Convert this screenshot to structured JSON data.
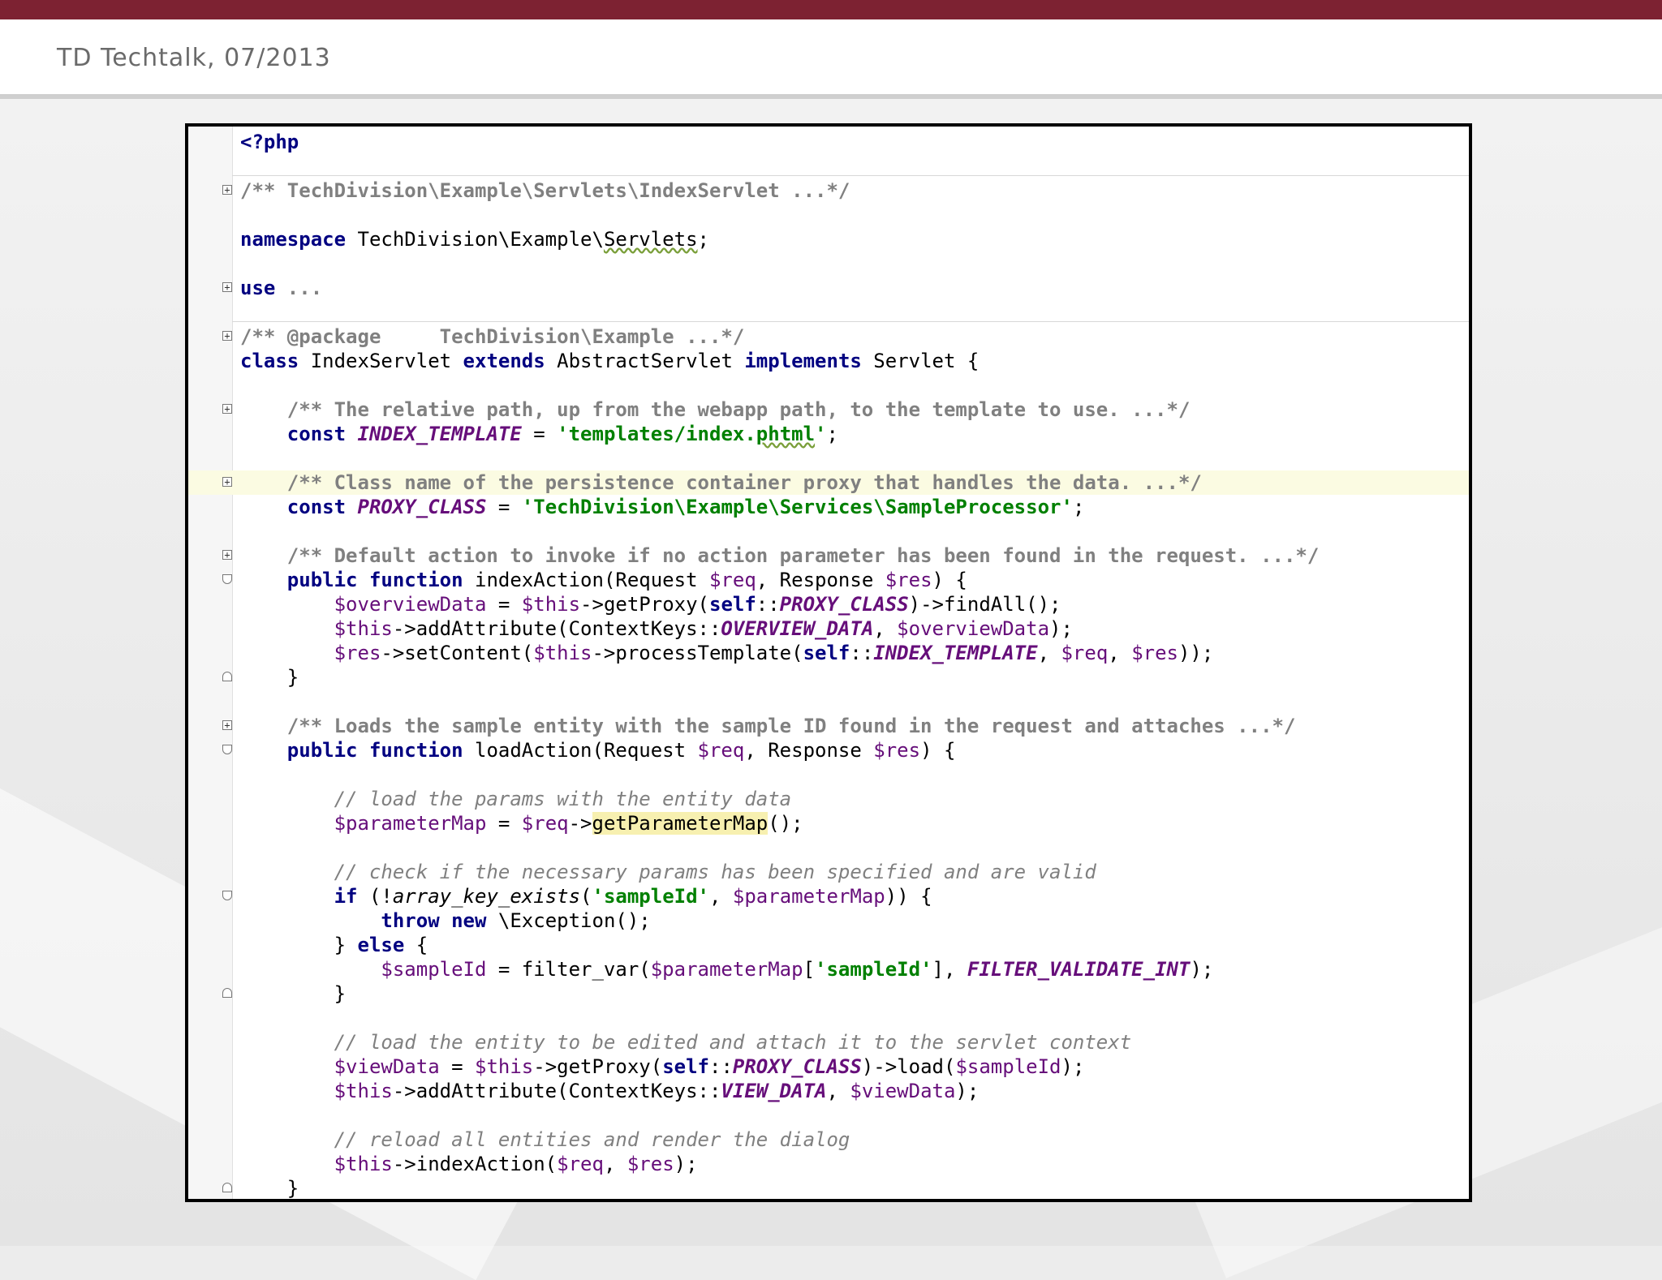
{
  "header": {
    "title": "TD Techtalk, 07/2013"
  },
  "editor": {
    "lines": {
      "php_open": "<?php",
      "file_doc": "/** TechDivision\\Example\\Servlets\\IndexServlet ...*/",
      "namespace_kw": "namespace",
      "namespace_path": " TechDivision\\Example\\",
      "namespace_name": "Servlets",
      "namespace_end": ";",
      "use_kw": "use",
      "use_rest": " ...",
      "package_doc": "/** @package     TechDivision\\Example ...*/",
      "class_kw": "class",
      "class_name": " IndexServlet ",
      "extends_kw": "extends",
      "parent_name": " AbstractServlet ",
      "implements_kw": "implements",
      "iface_name": " Servlet {",
      "doc_template": "/** The relative path, up from the webapp path, to the template to use. ...*/",
      "const1_kw": "const",
      "const1_name": "INDEX_TEMPLATE",
      "const1_eq": " = ",
      "const1_val_a": "'templates/index.",
      "const1_val_b": "phtml",
      "const1_val_c": "'",
      "const1_end": ";",
      "doc_proxy": "/** Class name of the persistence container proxy that handles the data. ...*/",
      "const2_kw": "const",
      "const2_name": "PROXY_CLASS",
      "const2_eq": " = ",
      "const2_val": "'TechDivision\\Example\\Services\\SampleProcessor'",
      "const2_end": ";",
      "doc_default": "/** Default action to invoke if no action parameter has been found in the request. ...*/",
      "idx_public": "public",
      "idx_function": "function",
      "idx_sig_a": " indexAction(Request ",
      "idx_req": "$req",
      "idx_sig_b": ", Response ",
      "idx_res": "$res",
      "idx_sig_c": ") {",
      "l1_var": "$overviewData",
      "l1_a": " = ",
      "l1_this": "$this",
      "l1_b": "->getProxy(",
      "l1_self": "self",
      "l1_c": "::",
      "l1_const": "PROXY_CLASS",
      "l1_d": ")->findAll();",
      "l2_this": "$this",
      "l2_a": "->addAttribute(ContextKeys::",
      "l2_const": "OVERVIEW_DATA",
      "l2_b": ", ",
      "l2_var": "$overviewData",
      "l2_c": ");",
      "l3_res": "$res",
      "l3_a": "->setContent(",
      "l3_this": "$this",
      "l3_b": "->processTemplate(",
      "l3_self": "self",
      "l3_c": "::",
      "l3_const": "INDEX_TEMPLATE",
      "l3_d": ", ",
      "l3_req": "$req",
      "l3_e": ", ",
      "l3_res2": "$res",
      "l3_f": "));",
      "close_brace": "}",
      "doc_load": "/** Loads the sample entity with the sample ID found in the request and attaches ...*/",
      "load_public": "public",
      "load_function": "function",
      "load_sig_a": " loadAction(Request ",
      "load_req": "$req",
      "load_sig_b": ", Response ",
      "load_res": "$res",
      "load_sig_c": ") {",
      "cmt_load_params": "// load the params with the entity data",
      "pm_var": "$parameterMap",
      "pm_a": " = ",
      "pm_req": "$req",
      "pm_b": "->",
      "pm_method": "getParameterMap",
      "pm_c": "();",
      "cmt_check": "// check if the necessary params has been specified and are valid",
      "if_kw": "if",
      "if_a": " (!",
      "if_func": "array_key_exists",
      "if_b": "(",
      "if_str": "'sampleId'",
      "if_c": ", ",
      "if_var": "$parameterMap",
      "if_d": ")) {",
      "throw_kw": "throw",
      "new_kw": "new",
      "throw_rest": " \\Exception();",
      "else_a": "} ",
      "else_kw": "else",
      "else_b": " {",
      "sid_var": "$sampleId",
      "sid_a": " = filter_var(",
      "sid_pm": "$parameterMap",
      "sid_b": "[",
      "sid_str": "'sampleId'",
      "sid_c": "], ",
      "sid_const": "FILTER_VALIDATE_INT",
      "sid_d": ");",
      "cmt_load_entity": "// load the entity to be edited and attach it to the servlet context",
      "vd_var": "$viewData",
      "vd_a": " = ",
      "vd_this": "$this",
      "vd_b": "->getProxy(",
      "vd_self": "self",
      "vd_c": "::",
      "vd_const": "PROXY_CLASS",
      "vd_d": ")->load(",
      "vd_sid": "$sampleId",
      "vd_e": ");",
      "va_this": "$this",
      "va_a": "->addAttribute(ContextKeys::",
      "va_const": "VIEW_DATA",
      "va_b": ", ",
      "va_var": "$viewData",
      "va_c": ");",
      "cmt_reload": "// reload all entities and render the dialog",
      "ia_this": "$this",
      "ia_a": "->indexAction(",
      "ia_req": "$req",
      "ia_b": ", ",
      "ia_res": "$res",
      "ia_c": ");"
    }
  },
  "colors": {
    "top_bar": "#7d2232",
    "keyword": "#000080",
    "string": "#008000",
    "variable": "#660e7a",
    "comment": "#808080",
    "line_highlight": "#fbfbe2"
  }
}
